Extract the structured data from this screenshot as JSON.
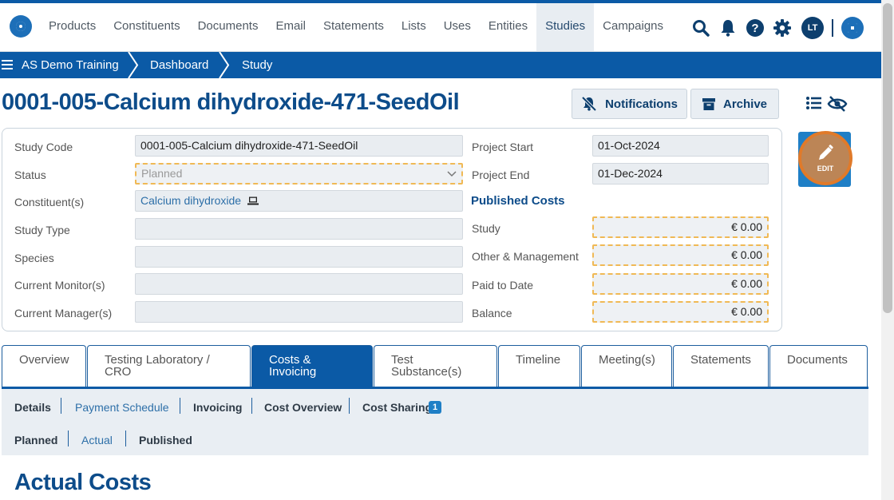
{
  "nav": {
    "items": [
      "Products",
      "Constituents",
      "Documents",
      "Email",
      "Statements",
      "Lists",
      "Uses",
      "Entities",
      "Studies",
      "Campaigns"
    ],
    "active": "Studies",
    "user_initials": "LT"
  },
  "breadcrumb": {
    "root": "AS Demo Training",
    "level2": "Dashboard",
    "level3": "Study"
  },
  "page": {
    "title": "0001-005-Calcium dihydroxide-471-SeedOil",
    "notifications_label": "Notifications",
    "archive_label": "Archive",
    "edit_label": "EDIT"
  },
  "study": {
    "study_code_label": "Study Code",
    "study_code": "0001-005-Calcium dihydroxide-471-SeedOil",
    "status_label": "Status",
    "status": "Planned",
    "constituents_label": "Constituent(s)",
    "constituent": "Calcium dihydroxide",
    "study_type_label": "Study Type",
    "study_type": "",
    "species_label": "Species",
    "species": "",
    "monitor_label": "Current Monitor(s)",
    "monitor": "",
    "manager_label": "Current Manager(s)",
    "manager": "",
    "project_start_label": "Project Start",
    "project_start": "01-Oct-2024",
    "project_end_label": "Project End",
    "project_end": "01-Dec-2024"
  },
  "published_costs": {
    "heading": "Published Costs",
    "study_label": "Study",
    "study": "€ 0.00",
    "other_label": "Other & Management",
    "other": "€ 0.00",
    "paid_label": "Paid to Date",
    "paid": "€ 0.00",
    "balance_label": "Balance",
    "balance": "€ 0.00"
  },
  "tabs": [
    {
      "l1": "Overview",
      "l2": ""
    },
    {
      "l1": "Testing Laboratory /",
      "l2": "CRO"
    },
    {
      "l1": "Costs &",
      "l2": "Invoicing"
    },
    {
      "l1": "Test",
      "l2": "Substance(s)"
    },
    {
      "l1": "Timeline",
      "l2": ""
    },
    {
      "l1": "Meeting(s)",
      "l2": ""
    },
    {
      "l1": "Statements",
      "l2": ""
    },
    {
      "l1": "Documents",
      "l2": ""
    }
  ],
  "subnav": {
    "details": "Details",
    "payment_schedule": "Payment Schedule",
    "invoicing": "Invoicing",
    "cost_overview": "Cost Overview",
    "cost_sharing": "Cost Sharing",
    "cost_sharing_count": "1",
    "planned": "Planned",
    "actual": "Actual",
    "published": "Published"
  },
  "section_title": "Actual Costs",
  "colors": {
    "primary": "#0b5aa6",
    "title": "#0d4c8a",
    "highlight": "#e07a2a"
  }
}
